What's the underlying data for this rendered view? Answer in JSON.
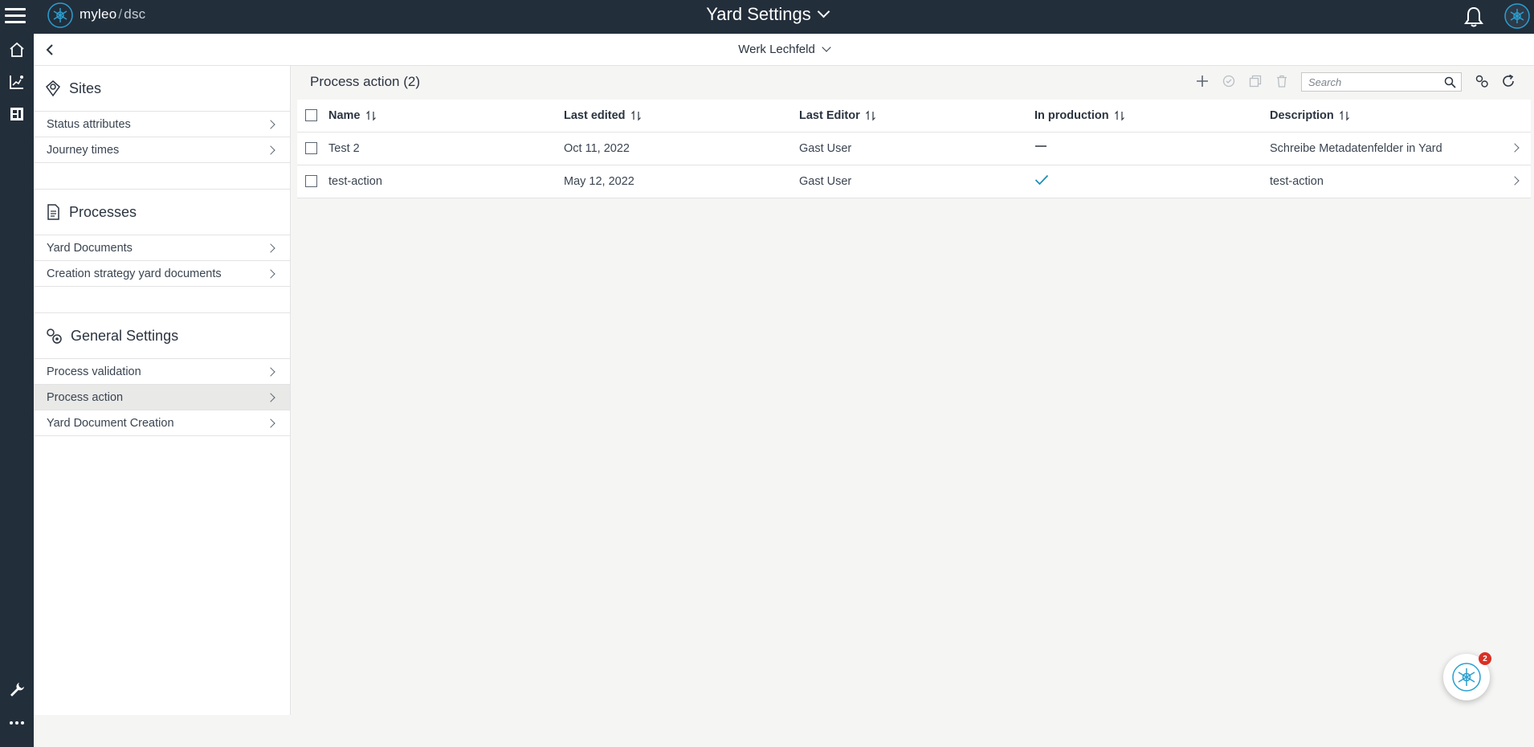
{
  "app": {
    "brand": "myleo",
    "brand_sep": "/",
    "brand_sub": "dsc",
    "title": "Yard Settings"
  },
  "subheader": {
    "site": "Werk Lechfeld"
  },
  "sidebar": {
    "sections": [
      {
        "title": "Sites",
        "icon": "location-pin-icon",
        "items": [
          {
            "label": "Status attributes",
            "active": false
          },
          {
            "label": "Journey times",
            "active": false
          }
        ]
      },
      {
        "title": "Processes",
        "icon": "document-icon",
        "items": [
          {
            "label": "Yard Documents",
            "active": false
          },
          {
            "label": "Creation strategy yard documents",
            "active": false
          }
        ]
      },
      {
        "title": "General Settings",
        "icon": "gears-icon",
        "items": [
          {
            "label": "Process validation",
            "active": false
          },
          {
            "label": "Process action",
            "active": true
          },
          {
            "label": "Yard Document Creation",
            "active": false
          }
        ]
      }
    ]
  },
  "main": {
    "title": "Process action (2)",
    "search": {
      "placeholder": "Search",
      "value": ""
    },
    "columns": [
      "Name",
      "Last edited",
      "Last Editor",
      "In production",
      "Description"
    ],
    "rows": [
      {
        "name": "Test 2",
        "last_edited": "Oct 11, 2022",
        "last_editor": "Gast User",
        "in_production": "dash",
        "description": "Schreibe Metadatenfelder in Yard"
      },
      {
        "name": "test-action",
        "last_edited": "May 12, 2022",
        "last_editor": "Gast User",
        "in_production": "check",
        "description": "test-action"
      }
    ]
  },
  "fab": {
    "badge": "2"
  },
  "colors": {
    "nav_bg": "#232e3b",
    "accent": "#1f8fb5",
    "badge": "#d93025",
    "page_bg": "#f5f5f4"
  }
}
